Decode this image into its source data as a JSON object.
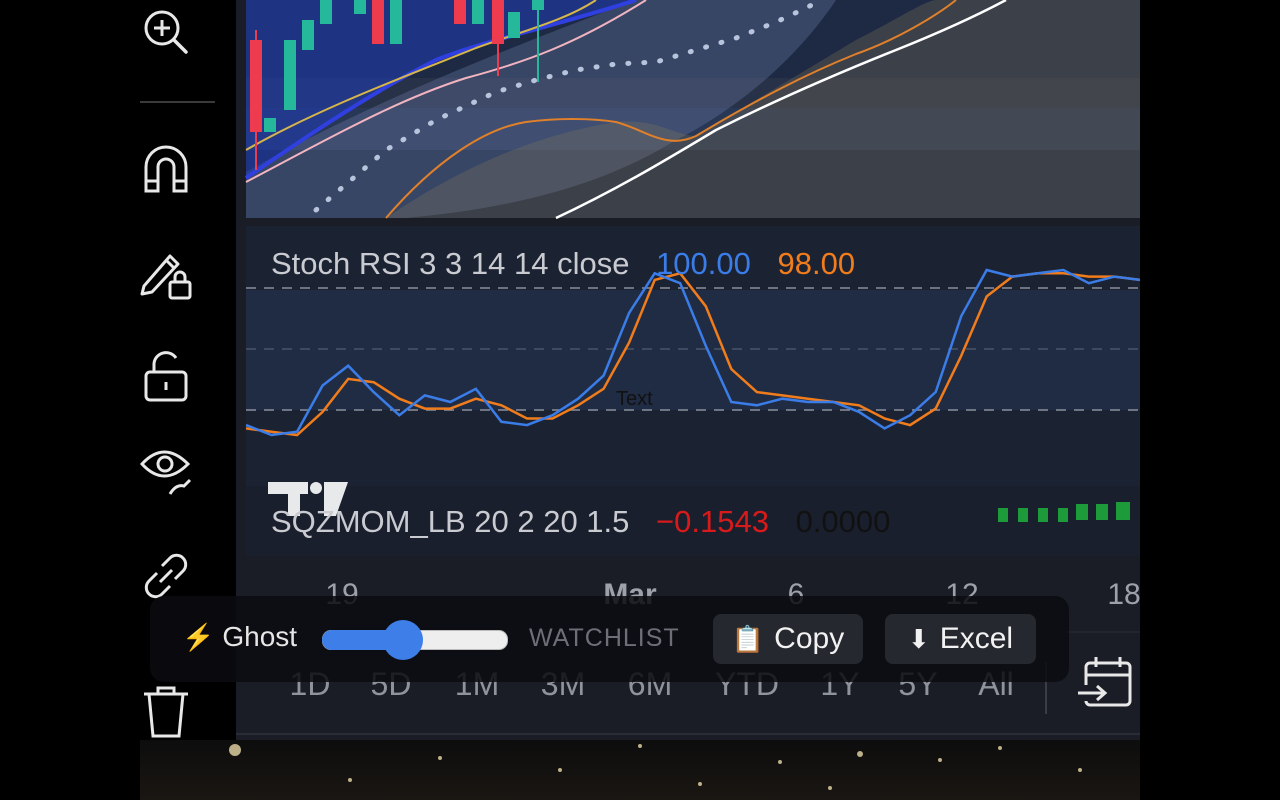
{
  "toolbar": {
    "items": [
      {
        "name": "zoom-in",
        "icon": "zoom-in-icon"
      },
      {
        "name": "magnet",
        "icon": "magnet-icon"
      },
      {
        "name": "lock-drawings",
        "icon": "pencil-lock-icon"
      },
      {
        "name": "lock",
        "icon": "lock-open-icon"
      },
      {
        "name": "hide",
        "icon": "eye-icon"
      },
      {
        "name": "link",
        "icon": "link-icon"
      },
      {
        "name": "delete",
        "icon": "trash-icon"
      }
    ]
  },
  "indicators": {
    "stoch_rsi": {
      "label": "Stoch RSI 3 3 14 14 close",
      "k_value": "100.00",
      "d_value": "98.00",
      "k_color": "#3b7de8",
      "d_color": "#f07c1c"
    },
    "sqzmom": {
      "label": "SQZMOM_LB 20 2 20 1.5",
      "value1": "−0.1543",
      "value2": "0.0000",
      "value1_color": "#d91a1a"
    },
    "text_annotation": "Text"
  },
  "time_axis": {
    "ticks": [
      "19",
      "Mar",
      "6",
      "12",
      "18"
    ],
    "bold_tick": "Mar"
  },
  "range_bar": {
    "buttons": [
      "1D",
      "5D",
      "1M",
      "3M",
      "6M",
      "YTD",
      "1Y",
      "5Y",
      "All"
    ],
    "calendar_icon": "calendar-goto-icon"
  },
  "ghost_panel": {
    "ghost_label": "Ghost",
    "slider_fraction": 0.33,
    "watchlist_label": "WATCHLIST",
    "copy_label": "Copy",
    "excel_label": "Excel"
  },
  "colors": {
    "background": "#1a1d26",
    "up_candle": "#26a69a",
    "down_candle": "#ef5350",
    "stoch_k": "#3b7de8",
    "stoch_d": "#f07c1c"
  },
  "chart_data": {
    "type": "line",
    "series": [
      {
        "name": "Stoch RSI K",
        "values": [
          6,
          0,
          2,
          30,
          42,
          26,
          12,
          24,
          20,
          28,
          8,
          6,
          12,
          22,
          36,
          74,
          98,
          92,
          54,
          20,
          18,
          22,
          20,
          20,
          14,
          4,
          12,
          26,
          72,
          100,
          96,
          98,
          100,
          92,
          96,
          94
        ]
      },
      {
        "name": "Stoch RSI D",
        "values": [
          4,
          2,
          0,
          14,
          34,
          32,
          22,
          16,
          16,
          22,
          18,
          10,
          10,
          18,
          28,
          56,
          94,
          98,
          78,
          40,
          26,
          24,
          22,
          20,
          18,
          10,
          6,
          16,
          48,
          84,
          96,
          98,
          98,
          96,
          96,
          94
        ]
      }
    ]
  }
}
